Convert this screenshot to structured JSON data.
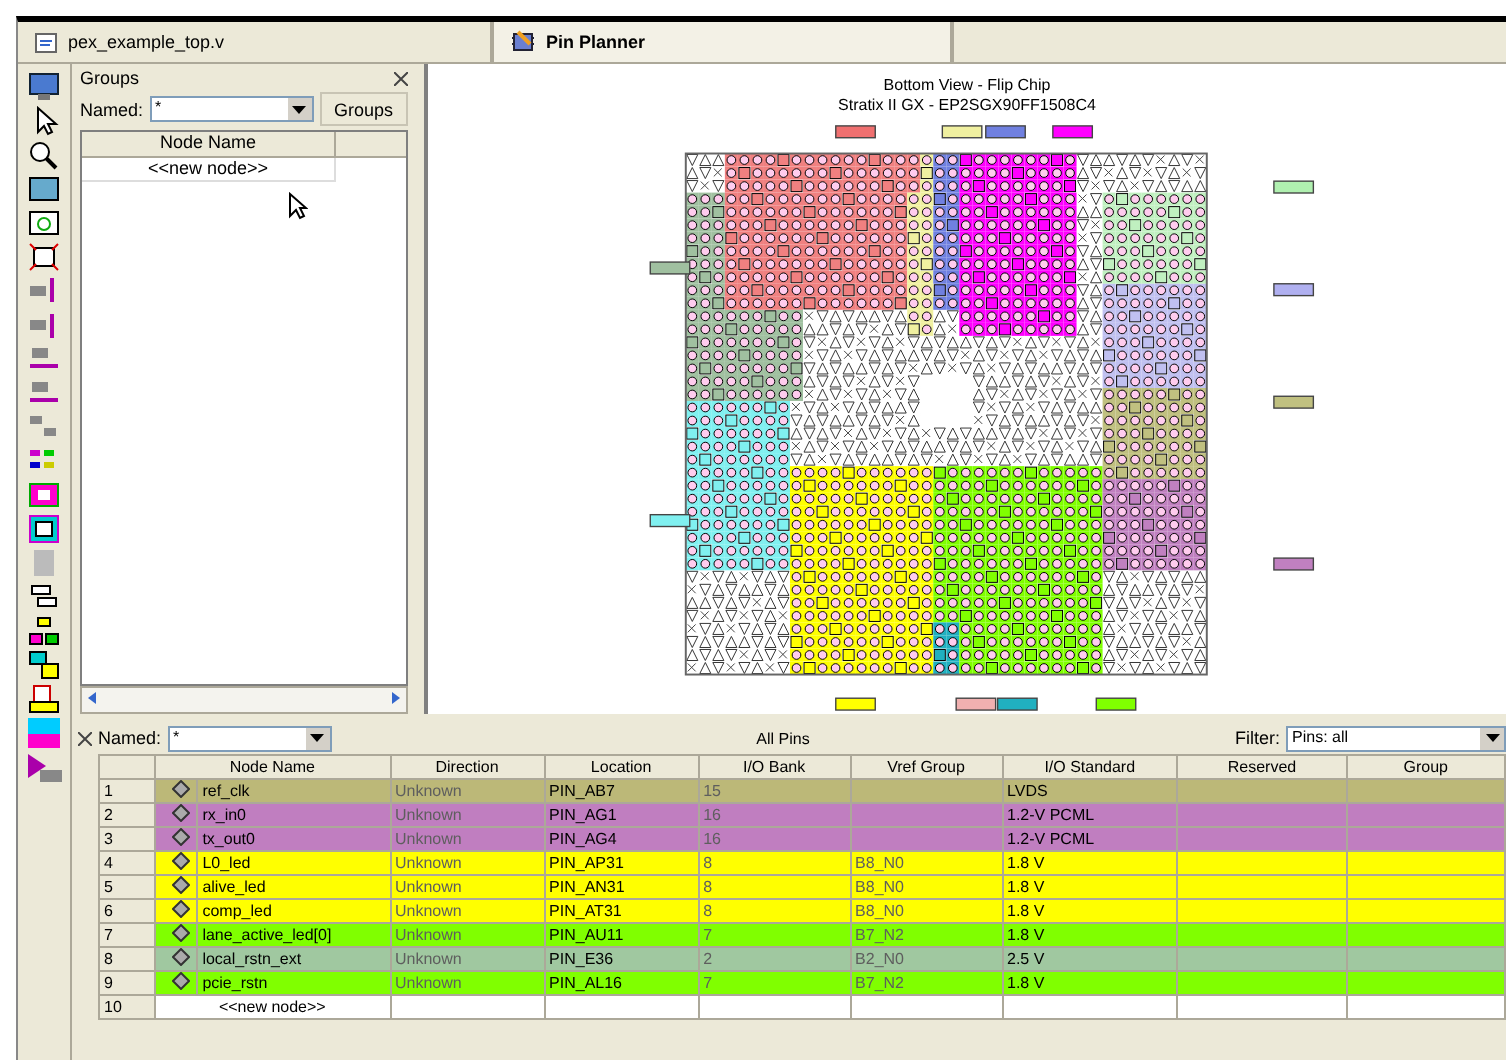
{
  "tabs": [
    {
      "label": "pex_example_top.v",
      "selected": false
    },
    {
      "label": "Pin Planner",
      "selected": true
    }
  ],
  "groups_panel": {
    "title": "Groups",
    "named_label": "Named:",
    "named_value": "*",
    "groups_button": "Groups",
    "columns": [
      "Node Name"
    ],
    "rows": [
      "<<new node>>"
    ]
  },
  "chip_view": {
    "title": "Bottom View - Flip Chip",
    "subtitle": "Stratix II GX - EP2SGX90FF1508C4"
  },
  "pins_panel": {
    "named_label": "Named:",
    "named_value": "*",
    "title": "All Pins",
    "filter_label": "Filter:",
    "filter_value": "Pins: all",
    "columns": [
      "Node Name",
      "Direction",
      "Location",
      "I/O Bank",
      "Vref Group",
      "I/O Standard",
      "Reserved",
      "Group"
    ],
    "rows": [
      {
        "number": "1",
        "color": "#bcb878",
        "cells": [
          "ref_clk",
          "Unknown",
          "PIN_AB7",
          "15",
          "",
          "LVDS",
          "",
          ""
        ]
      },
      {
        "number": "2",
        "color": "#c07ec0",
        "cells": [
          "rx_in0",
          "Unknown",
          "PIN_AG1",
          "16",
          "",
          "1.2-V PCML",
          "",
          ""
        ]
      },
      {
        "number": "3",
        "color": "#c07ec0",
        "cells": [
          "tx_out0",
          "Unknown",
          "PIN_AG4",
          "16",
          "",
          "1.2-V PCML",
          "",
          ""
        ]
      },
      {
        "number": "4",
        "color": "#ffff00",
        "cells": [
          "L0_led",
          "Unknown",
          "PIN_AP31",
          "8",
          "B8_N0",
          "1.8 V",
          "",
          ""
        ]
      },
      {
        "number": "5",
        "color": "#ffff00",
        "cells": [
          "alive_led",
          "Unknown",
          "PIN_AN31",
          "8",
          "B8_N0",
          "1.8 V",
          "",
          ""
        ]
      },
      {
        "number": "6",
        "color": "#ffff00",
        "cells": [
          "comp_led",
          "Unknown",
          "PIN_AT31",
          "8",
          "B8_N0",
          "1.8 V",
          "",
          ""
        ]
      },
      {
        "number": "7",
        "color": "#80ff00",
        "cells": [
          "lane_active_led[0]",
          "Unknown",
          "PIN_AU11",
          "7",
          "B7_N2",
          "1.8 V",
          "",
          ""
        ]
      },
      {
        "number": "8",
        "color": "#a0c8a0",
        "cells": [
          "local_rstn_ext",
          "Unknown",
          "PIN_E36",
          "2",
          "B2_N0",
          "2.5 V",
          "",
          ""
        ]
      },
      {
        "number": "9",
        "color": "#80ff00",
        "cells": [
          "pcie_rstn",
          "Unknown",
          "PIN_AL16",
          "7",
          "B7_N2",
          "1.8 V",
          "",
          ""
        ]
      }
    ],
    "new_row": {
      "number": "10",
      "label": "<<new node>>"
    }
  }
}
